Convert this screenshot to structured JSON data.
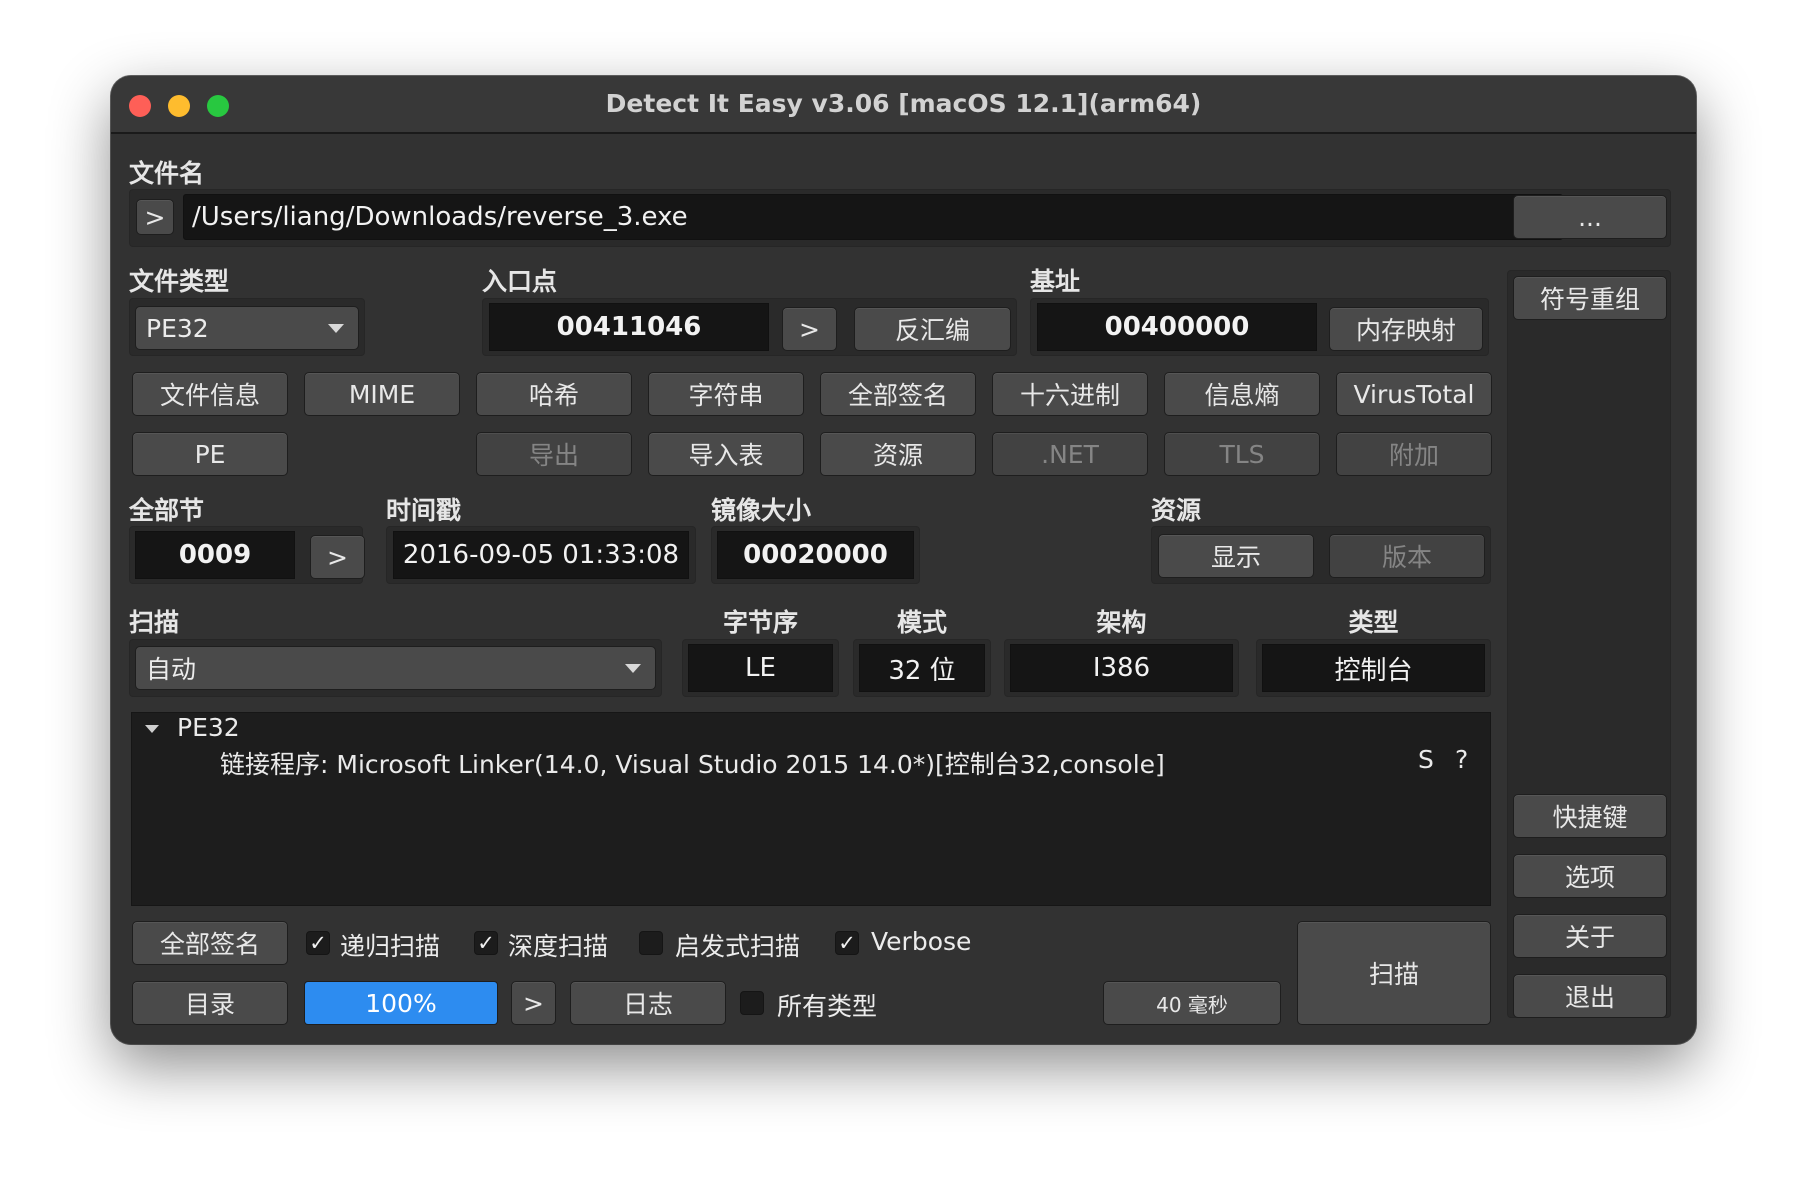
{
  "window": {
    "title": "Detect It Easy v3.06 [macOS 12.1](arm64)"
  },
  "file": {
    "label": "文件名",
    "expand_label": ">",
    "path": "/Users/liang/Downloads/reverse_3.exe",
    "browse_label": "..."
  },
  "side": {
    "regroup_label": "符号重组",
    "shortcuts_label": "快捷键",
    "options_label": "选项",
    "about_label": "关于",
    "exit_label": "退出"
  },
  "filetype": {
    "label": "文件类型",
    "value": "PE32"
  },
  "entry": {
    "label": "入口点",
    "value": "00411046",
    "go_label": ">",
    "disasm_label": "反汇编"
  },
  "base": {
    "label": "基址",
    "value": "00400000",
    "memmap_label": "内存映射"
  },
  "tools_row1": [
    "文件信息",
    "MIME",
    "哈希",
    "字符串",
    "全部签名",
    "十六进制",
    "信息熵",
    "VirusTotal"
  ],
  "tools_row2": {
    "pe": "PE",
    "export": "导出",
    "import": "导入表",
    "resources": "资源",
    "dotnet": ".NET",
    "tls": "TLS",
    "overlay": "附加"
  },
  "sections": {
    "label": "全部节",
    "value": "0009",
    "go_label": ">"
  },
  "timestamp": {
    "label": "时间戳",
    "value": "2016-09-05 01:33:08"
  },
  "image_size": {
    "label": "镜像大小",
    "value": "00020000"
  },
  "resources": {
    "label": "资源",
    "show_label": "显示",
    "version_label": "版本"
  },
  "scan": {
    "label": "扫描",
    "mode": "自动"
  },
  "info": {
    "endian_label": "字节序",
    "endian": "LE",
    "mode_label": "模式",
    "mode": "32 位",
    "arch_label": "架构",
    "arch": "I386",
    "type_label": "类型",
    "type": "控制台"
  },
  "results": {
    "root": "PE32",
    "line": "链接程序: Microsoft Linker(14.0, Visual Studio 2015 14.0*)[控制台32,console]",
    "s_label": "S",
    "q_label": "?"
  },
  "bottom": {
    "signatures_label": "全部签名",
    "recursive_label": "递归扫描",
    "recursive_checked": true,
    "deep_label": "深度扫描",
    "deep_checked": true,
    "heuristic_label": "启发式扫描",
    "heuristic_checked": false,
    "verbose_label": "Verbose",
    "verbose_checked": true,
    "directory_label": "目录",
    "progress_text": "100%",
    "progress_value": 1.0,
    "progress_go_label": ">",
    "log_label": "日志",
    "alltypes_label": "所有类型",
    "alltypes_checked": false,
    "elapsed": "40 毫秒",
    "scan_label": "扫描",
    "check_mark": "✓"
  },
  "colors": {
    "accent": "#2d8cf0",
    "background": "#323232",
    "field": "#151515"
  }
}
